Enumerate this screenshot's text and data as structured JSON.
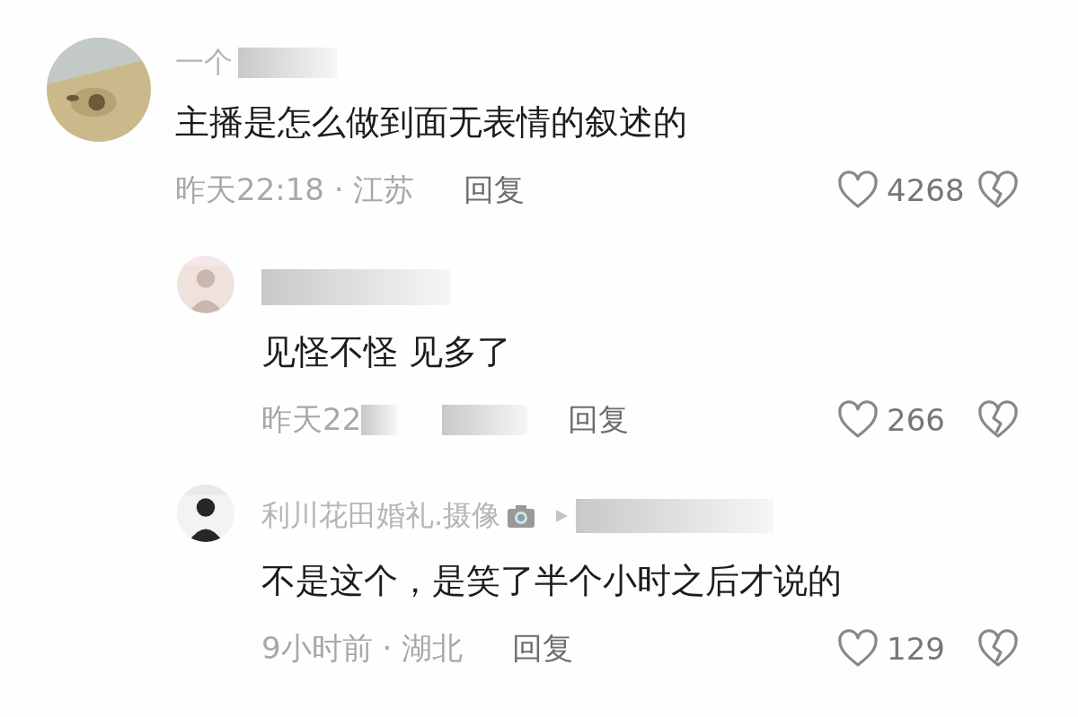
{
  "comments": [
    {
      "name": "一个",
      "name_obscured": true,
      "text": "主播是怎么做到面无表情的叙述的",
      "meta": "昨天22:18 · 江苏",
      "reply": "回复",
      "likes": "4268",
      "replies": [
        {
          "name_obscured": true,
          "text": "见怪不怪  见多了",
          "meta": "昨天22",
          "meta_obscured": true,
          "reply": "回复",
          "likes": "266"
        },
        {
          "name": "利川花田婚礼.摄像",
          "reply_to_obscured": true,
          "text": "不是这个，是笑了半个小时之后才说的",
          "meta": "9小时前 · 湖北",
          "reply": "回复",
          "likes": "129"
        }
      ]
    }
  ]
}
